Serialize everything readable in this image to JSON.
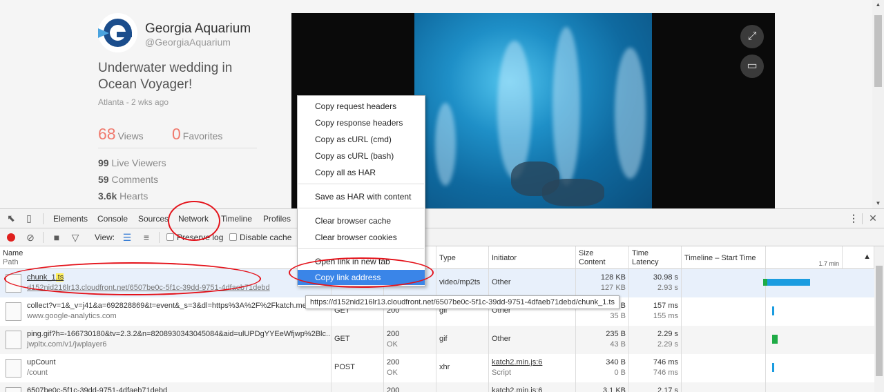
{
  "profile": {
    "name": "Georgia Aquarium",
    "handle": "@GeorgiaAquarium",
    "title": "Underwater wedding in Ocean Voyager!",
    "meta": "Atlanta - 2 wks ago",
    "views_num": "68",
    "views_label": "Views",
    "favorites_num": "0",
    "favorites_label": "Favorites",
    "stats": [
      {
        "num": "99",
        "label": "Live Viewers"
      },
      {
        "num": "59",
        "label": "Comments"
      },
      {
        "num": "3.6k",
        "label": "Hearts"
      }
    ]
  },
  "devtools": {
    "tabs": [
      "Elements",
      "Console",
      "Sources",
      "Network",
      "Timeline",
      "Profiles"
    ],
    "view_label": "View:",
    "preserve_log": "Preserve log",
    "disable_cache": "Disable cache",
    "columns": {
      "name": "Name",
      "path": "Path",
      "type": "Type",
      "initiator": "Initiator",
      "size": "Size",
      "content": "Content",
      "time": "Time",
      "latency": "Latency",
      "timeline": "Timeline – Start Time",
      "timeline_scale": "1.7 min"
    },
    "rows": [
      {
        "name_a": "chunk_1",
        "name_hl": ".ts",
        "path": "d152nid216lr13.cloudfront.net/6507be0c-5f1c-39dd-9751-4dfaeb71debd",
        "method": "",
        "status": "",
        "status_text": "",
        "type": "video/mp2ts",
        "initiator": "Other",
        "initiator_sub": "",
        "size": "128 KB",
        "content": "127 KB",
        "time": "30.98 s",
        "latency": "2.93 s"
      },
      {
        "name_a": "collect?v=1&_v=j41&a=692828869&t=event&_s=3&dl=https%3A%2F%2Fkatch.me",
        "name_hl": "",
        "path": "www.google-analytics.com",
        "method": "GET",
        "status": "200",
        "status_text": "",
        "type": "gif",
        "initiator": "Other",
        "initiator_sub": "",
        "size": "35 B",
        "content": "35 B",
        "time": "157 ms",
        "latency": "155 ms"
      },
      {
        "name_a": "ping.gif?h=-166730180&tv=2.3.2&n=8208930343045084&aid=ulUPDgYYEeWfjwp%2Blc...",
        "name_hl": "",
        "path": "jwpltx.com/v1/jwplayer6",
        "method": "GET",
        "status": "200",
        "status_text": "OK",
        "type": "gif",
        "initiator": "Other",
        "initiator_sub": "",
        "size": "235 B",
        "content": "43 B",
        "time": "2.29 s",
        "latency": "2.29 s"
      },
      {
        "name_a": "upCount",
        "name_hl": "",
        "path": "/count",
        "method": "POST",
        "status": "200",
        "status_text": "OK",
        "type": "xhr",
        "initiator": "katch2.min.js:6",
        "initiator_sub": "Script",
        "size": "340 B",
        "content": "0 B",
        "time": "746 ms",
        "latency": "746 ms"
      },
      {
        "name_a": "6507be0c-5f1c-39dd-9751-4dfaeb71debd",
        "name_hl": "",
        "path": "",
        "method": "",
        "status": "200",
        "status_text": "",
        "type": "",
        "initiator": "katch2.min.js:6",
        "initiator_sub": "",
        "size": "3.1 KB",
        "content": "",
        "time": "2.17 s",
        "latency": ""
      }
    ]
  },
  "context_menu": {
    "items": [
      "Copy request headers",
      "Copy response headers",
      "Copy as cURL (cmd)",
      "Copy as cURL (bash)",
      "Copy all as HAR",
      "Save as HAR with content",
      "Clear browser cache",
      "Clear browser cookies",
      "Open link in new tab",
      "Copy link address"
    ]
  },
  "tooltip": "https://d152nid216lr13.cloudfront.net/6507be0c-5f1c-39dd-9751-4dfaeb71debd/chunk_1.ts",
  "colors": {
    "accent": "#f07a6e",
    "menu_active": "#3a85e8",
    "annotation": "#e4121a"
  }
}
